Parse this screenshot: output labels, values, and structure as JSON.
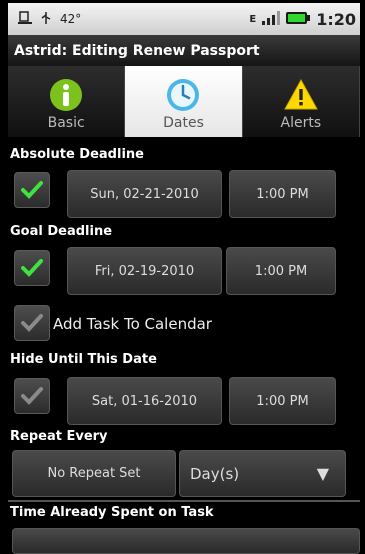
{
  "status": {
    "temperature": "42°",
    "time": "1:20"
  },
  "title": "Astrid: Editing Renew Passport",
  "tabs": [
    {
      "label": "Basic",
      "icon": "info-icon"
    },
    {
      "label": "Dates",
      "icon": "clock-icon"
    },
    {
      "label": "Alerts",
      "icon": "warning-icon"
    }
  ],
  "absolute_deadline": {
    "label": "Absolute Deadline",
    "date": "Sun, 02-21-2010",
    "time": "1:00 PM"
  },
  "goal_deadline": {
    "label": "Goal Deadline",
    "date": "Fri, 02-19-2010",
    "time": "1:00 PM"
  },
  "calendar": {
    "label": "Add Task To Calendar"
  },
  "hide_until": {
    "label": "Hide Until This Date",
    "date": "Sat, 01-16-2010",
    "time": "1:00 PM"
  },
  "repeat": {
    "label": "Repeat Every",
    "button": "No Repeat Set",
    "unit": "Day(s)"
  },
  "time_spent": {
    "label": "Time Already Spent on Task"
  },
  "colors": {
    "check_green": "#3fe23f",
    "tab_active_bg": "#f2f2f2",
    "info_green": "#7cc21d",
    "clock_blue": "#4cb6e8",
    "warning_yellow": "#ffd800"
  }
}
